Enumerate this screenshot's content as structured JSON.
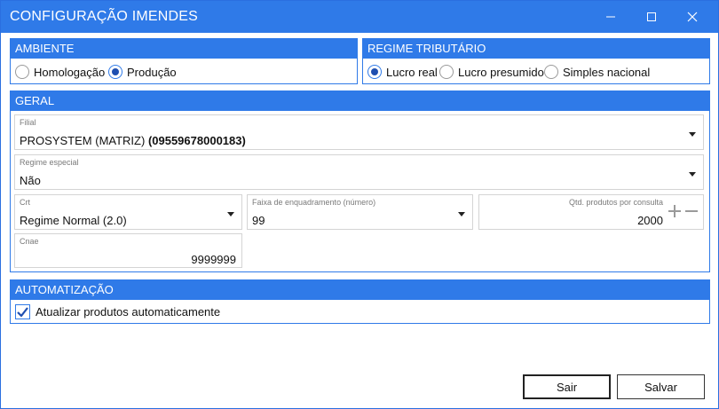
{
  "window": {
    "title": "CONFIGURAÇÃO IMENDES",
    "controls": {
      "minimize": "–",
      "maximize": "☐",
      "close": "✕"
    }
  },
  "ambiente": {
    "title": "AMBIENTE",
    "options": [
      {
        "label": "Homologação",
        "selected": false
      },
      {
        "label": "Produção",
        "selected": true
      }
    ]
  },
  "regime_tributario": {
    "title": "REGIME TRIBUTÁRIO",
    "options": [
      {
        "label": "Lucro real",
        "selected": true
      },
      {
        "label": "Lucro presumido",
        "selected": false
      },
      {
        "label": "Simples nacional",
        "selected": false
      }
    ]
  },
  "geral": {
    "title": "GERAL",
    "filial": {
      "label": "Filial",
      "value_name": "PROSYSTEM (MATRIZ)",
      "value_code": "(09559678000183)"
    },
    "regime_especial": {
      "label": "Regime especial",
      "value": "Não"
    },
    "crt": {
      "label": "Crt",
      "value": "Regime Normal (2.0)"
    },
    "faixa": {
      "label": "Faixa de enquadramento (número)",
      "value": "99"
    },
    "qtd": {
      "label": "Qtd. produtos por consulta",
      "value": "2000"
    },
    "cnae": {
      "label": "Cnae",
      "value": "9999999"
    }
  },
  "automatizacao": {
    "title": "AUTOMATIZAÇÃO",
    "checkbox": {
      "label": "Atualizar produtos automaticamente",
      "checked": true
    }
  },
  "buttons": {
    "sair": "Sair",
    "salvar": "Salvar"
  },
  "colors": {
    "accent": "#2f7ae8"
  }
}
